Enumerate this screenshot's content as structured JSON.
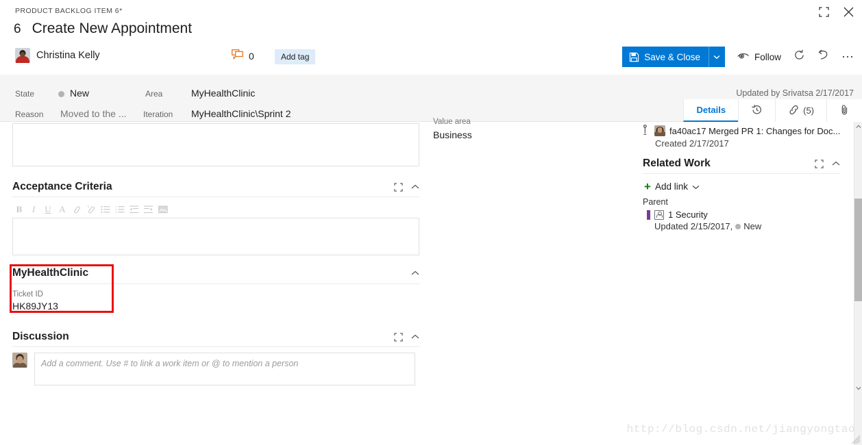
{
  "window": {
    "maximize_icon": "maximize-icon",
    "close_icon": "close-icon"
  },
  "header": {
    "work_item_type": "PRODUCT BACKLOG ITEM 6*",
    "id": "6",
    "title": "Create New Appointment",
    "assigned_to": "Christina Kelly",
    "assigned_avatar": "avatar-christina-kelly",
    "discussion_icon": "discussion-icon",
    "discussion_count": "0",
    "add_tag_label": "Add tag"
  },
  "toolbar": {
    "save_label": "Save & Close",
    "save_icon": "save-icon",
    "save_dropdown_icon": "chevron-down-icon",
    "follow_label": "Follow",
    "follow_icon": "eye-icon",
    "refresh_icon": "refresh-icon",
    "undo_icon": "undo-icon",
    "more_icon": "ellipsis-icon"
  },
  "fields": {
    "state_label": "State",
    "state_value": "New",
    "reason_label": "Reason",
    "reason_value": "Moved to the ...",
    "area_label": "Area",
    "area_value": "MyHealthClinic",
    "iteration_label": "Iteration",
    "iteration_value": "MyHealthClinic\\Sprint 2",
    "updated_by": "Updated by Srivatsa 2/17/2017"
  },
  "tabs": [
    {
      "label": "Details",
      "icon": "",
      "count": "",
      "active": true
    },
    {
      "label": "",
      "icon": "history-icon",
      "count": "",
      "active": false
    },
    {
      "label": "",
      "icon": "link-icon",
      "count": "(5)",
      "active": false
    },
    {
      "label": "",
      "icon": "attachment-icon",
      "count": "",
      "active": false
    }
  ],
  "main": {
    "description_box_placeholder": "",
    "acceptance_criteria": {
      "title": "Acceptance Criteria",
      "expand_icon": "expand-icon",
      "collapse_icon": "chevron-up-icon",
      "rte_buttons": [
        {
          "name": "bold-icon",
          "glyph": "B"
        },
        {
          "name": "italic-icon",
          "glyph": "I"
        },
        {
          "name": "underline-icon",
          "glyph": "U"
        },
        {
          "name": "clear-format-icon",
          "glyph": "A"
        },
        {
          "name": "link-icon",
          "glyph": "⚭"
        },
        {
          "name": "unlink-icon",
          "glyph": "⚭"
        },
        {
          "name": "bullet-list-icon",
          "glyph": "☰"
        },
        {
          "name": "numbered-list-icon",
          "glyph": "☰"
        },
        {
          "name": "outdent-icon",
          "glyph": "⇤"
        },
        {
          "name": "indent-icon",
          "glyph": "⇥"
        },
        {
          "name": "insert-image-icon",
          "glyph": "▣"
        }
      ],
      "content": ""
    },
    "custom_group": {
      "title": "MyHealthClinic",
      "collapse_icon": "chevron-up-icon",
      "field_label": "Ticket ID",
      "field_value": "HK89JY13",
      "highlight_color": "#e8110f"
    },
    "discussion": {
      "title": "Discussion",
      "expand_icon": "expand-icon",
      "collapse_icon": "chevron-up-icon",
      "avatar": "avatar-current-user",
      "placeholder": "Add a comment. Use # to link a work item or @ to mention a person"
    },
    "mid_column": {
      "value_area_label": "Value area",
      "value_area_value": "Business"
    }
  },
  "right_panel": {
    "development_item": {
      "branch_icon": "pull-request-icon",
      "avatar": "avatar-fa40ac17",
      "text": "fa40ac17 Merged PR 1: Changes for Doc...",
      "created": "Created 2/17/2017"
    },
    "related_work": {
      "title": "Related Work",
      "expand_icon": "expand-icon",
      "collapse_icon": "chevron-up-icon",
      "add_link_label": "Add link",
      "add_link_icon": "plus-icon",
      "add_link_chevron": "chevron-down-icon",
      "group_label": "Parent",
      "item": {
        "work_item_icon": "work-item-icon",
        "title": "1 Security",
        "meta_updated": "Updated 2/15/2017,",
        "meta_state": "New",
        "bar_color": "#773b93"
      }
    }
  },
  "scrollbar": {
    "up_icon": "chevron-up-icon",
    "down_icon": "chevron-down-icon"
  },
  "watermark": "http://blog.csdn.net/jiangyongtao",
  "colors": {
    "accent_blue": "#00a0d8",
    "primary_blue": "#0078d4",
    "highlight_red": "#e8110f",
    "green": "#107c10",
    "purple": "#773b93",
    "orange": "#e8761e"
  }
}
